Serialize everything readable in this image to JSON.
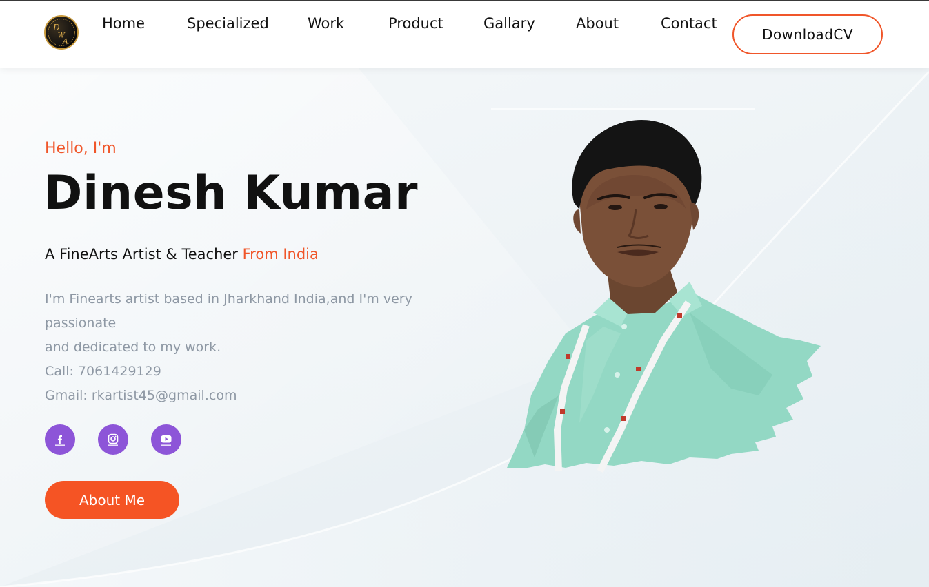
{
  "brand": {
    "logo_letters": "DWA",
    "logo_ring_text": "DINESH KUMAR ART"
  },
  "nav": {
    "items": [
      {
        "label": "Home"
      },
      {
        "label": "Specialized"
      },
      {
        "label": "Work"
      },
      {
        "label": "Product"
      },
      {
        "label": "Gallary"
      },
      {
        "label": "About"
      },
      {
        "label": "Contact"
      }
    ],
    "download_cv_label": "DownloadCV"
  },
  "hero": {
    "greeting": "Hello, I'm",
    "name": "Dinesh Kumar",
    "tagline_main": "A FineArts Artist & Teacher",
    "tagline_accent": "From India",
    "bio_lines": [
      "I'm Finearts artist based in Jharkhand India,and I'm very",
      "passionate",
      "and dedicated to my work.",
      "Call: 7061429129",
      "Gmail: rkartist45@gmail.com"
    ],
    "socials": [
      {
        "icon": "facebook-icon"
      },
      {
        "icon": "instagram-icon"
      },
      {
        "icon": "youtube-icon"
      }
    ],
    "about_button_label": "About Me",
    "portrait_alt": "Portrait photo"
  },
  "colors": {
    "accent": "#f0562a",
    "social": "#8d55d8",
    "text": "#111111",
    "muted": "#8e98a4",
    "shirt": "#93d8c4"
  }
}
